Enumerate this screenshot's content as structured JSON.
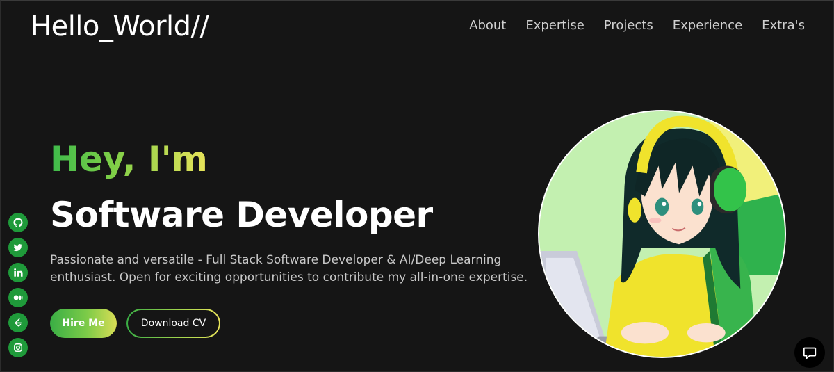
{
  "header": {
    "logo": "Hello_World//",
    "nav": [
      {
        "label": "About"
      },
      {
        "label": "Expertise"
      },
      {
        "label": "Projects"
      },
      {
        "label": "Experience"
      },
      {
        "label": "Extra's"
      }
    ]
  },
  "hero": {
    "greeting": "Hey, I'm",
    "role": "Software Developer",
    "description": "Passionate and versatile - Full Stack Software Developer & AI/Deep Learning enthusiast. Open for exciting opportunities to contribute my all-in-one expertise.",
    "hire_label": "Hire Me",
    "cv_label": "Download CV"
  },
  "socials": [
    {
      "icon": "github-icon"
    },
    {
      "icon": "twitter-icon"
    },
    {
      "icon": "linkedin-icon"
    },
    {
      "icon": "medium-icon"
    },
    {
      "icon": "leetcode-icon"
    },
    {
      "icon": "instagram-icon"
    }
  ],
  "colors": {
    "background": "#151515",
    "accent_green": "#3dba4b",
    "accent_yellow": "#e8e35a",
    "social_green": "#1f9a3a"
  }
}
